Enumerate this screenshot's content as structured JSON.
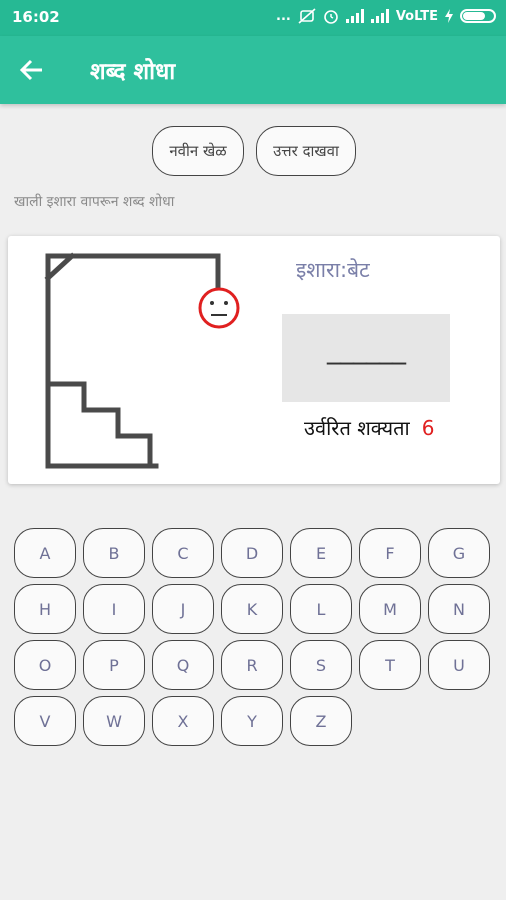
{
  "status_bar": {
    "time": "16:02",
    "icons_text": "...",
    "network": "VoLTE"
  },
  "appbar": {
    "title": "शब्द शोधा",
    "back_icon": "arrow-left-icon"
  },
  "controls": {
    "new_game": "नवीन खेळ",
    "show_answer": "उत्तर दाखवा"
  },
  "instruction": "खाली इशारा वापरून शब्द शोधा",
  "game": {
    "hint": "इशारा:बेट",
    "word_display": "______",
    "remaining_label": "उर्वरित शक्यता",
    "remaining_count": "6"
  },
  "keyboard": {
    "keys": [
      "A",
      "B",
      "C",
      "D",
      "E",
      "F",
      "G",
      "H",
      "I",
      "J",
      "K",
      "L",
      "M",
      "N",
      "O",
      "P",
      "Q",
      "R",
      "S",
      "T",
      "U",
      "V",
      "W",
      "X",
      "Y",
      "Z"
    ]
  },
  "colors": {
    "status_bar": "#26b994",
    "app_bar": "#2fc09d",
    "remaining_count": "#e02020",
    "face": "#e02020"
  }
}
